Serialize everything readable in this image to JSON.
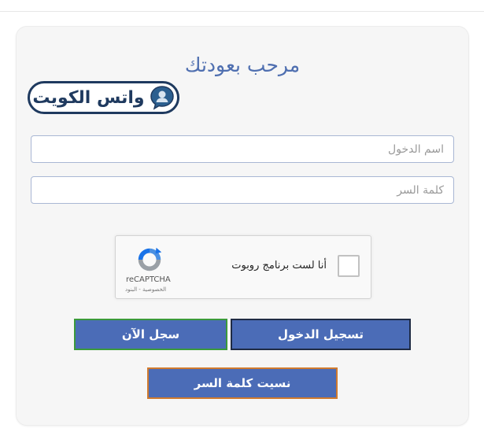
{
  "header": {
    "title": "مرحب بعودتك"
  },
  "logo": {
    "text": "واتس الكويت",
    "icon": "chat-bubble-person-icon"
  },
  "form": {
    "username_placeholder": "اسم الدخول",
    "password_placeholder": "كلمة السر"
  },
  "captcha": {
    "label": "أنا لست برنامج روبوت",
    "brand": "reCAPTCHA",
    "links": "الخصوصية - البنود",
    "icon": "recaptcha-icon"
  },
  "buttons": {
    "login": "تسجيل الدخول",
    "register": "سجل الآن",
    "forgot": "نسيت كلمة السر"
  },
  "colors": {
    "accent": "#4b6cb7",
    "title": "#4f6fb0",
    "login_border": "#1f2b44",
    "register_border": "#3b9a3b",
    "forgot_border": "#d07a2e",
    "logo_navy": "#1f3a5f"
  }
}
